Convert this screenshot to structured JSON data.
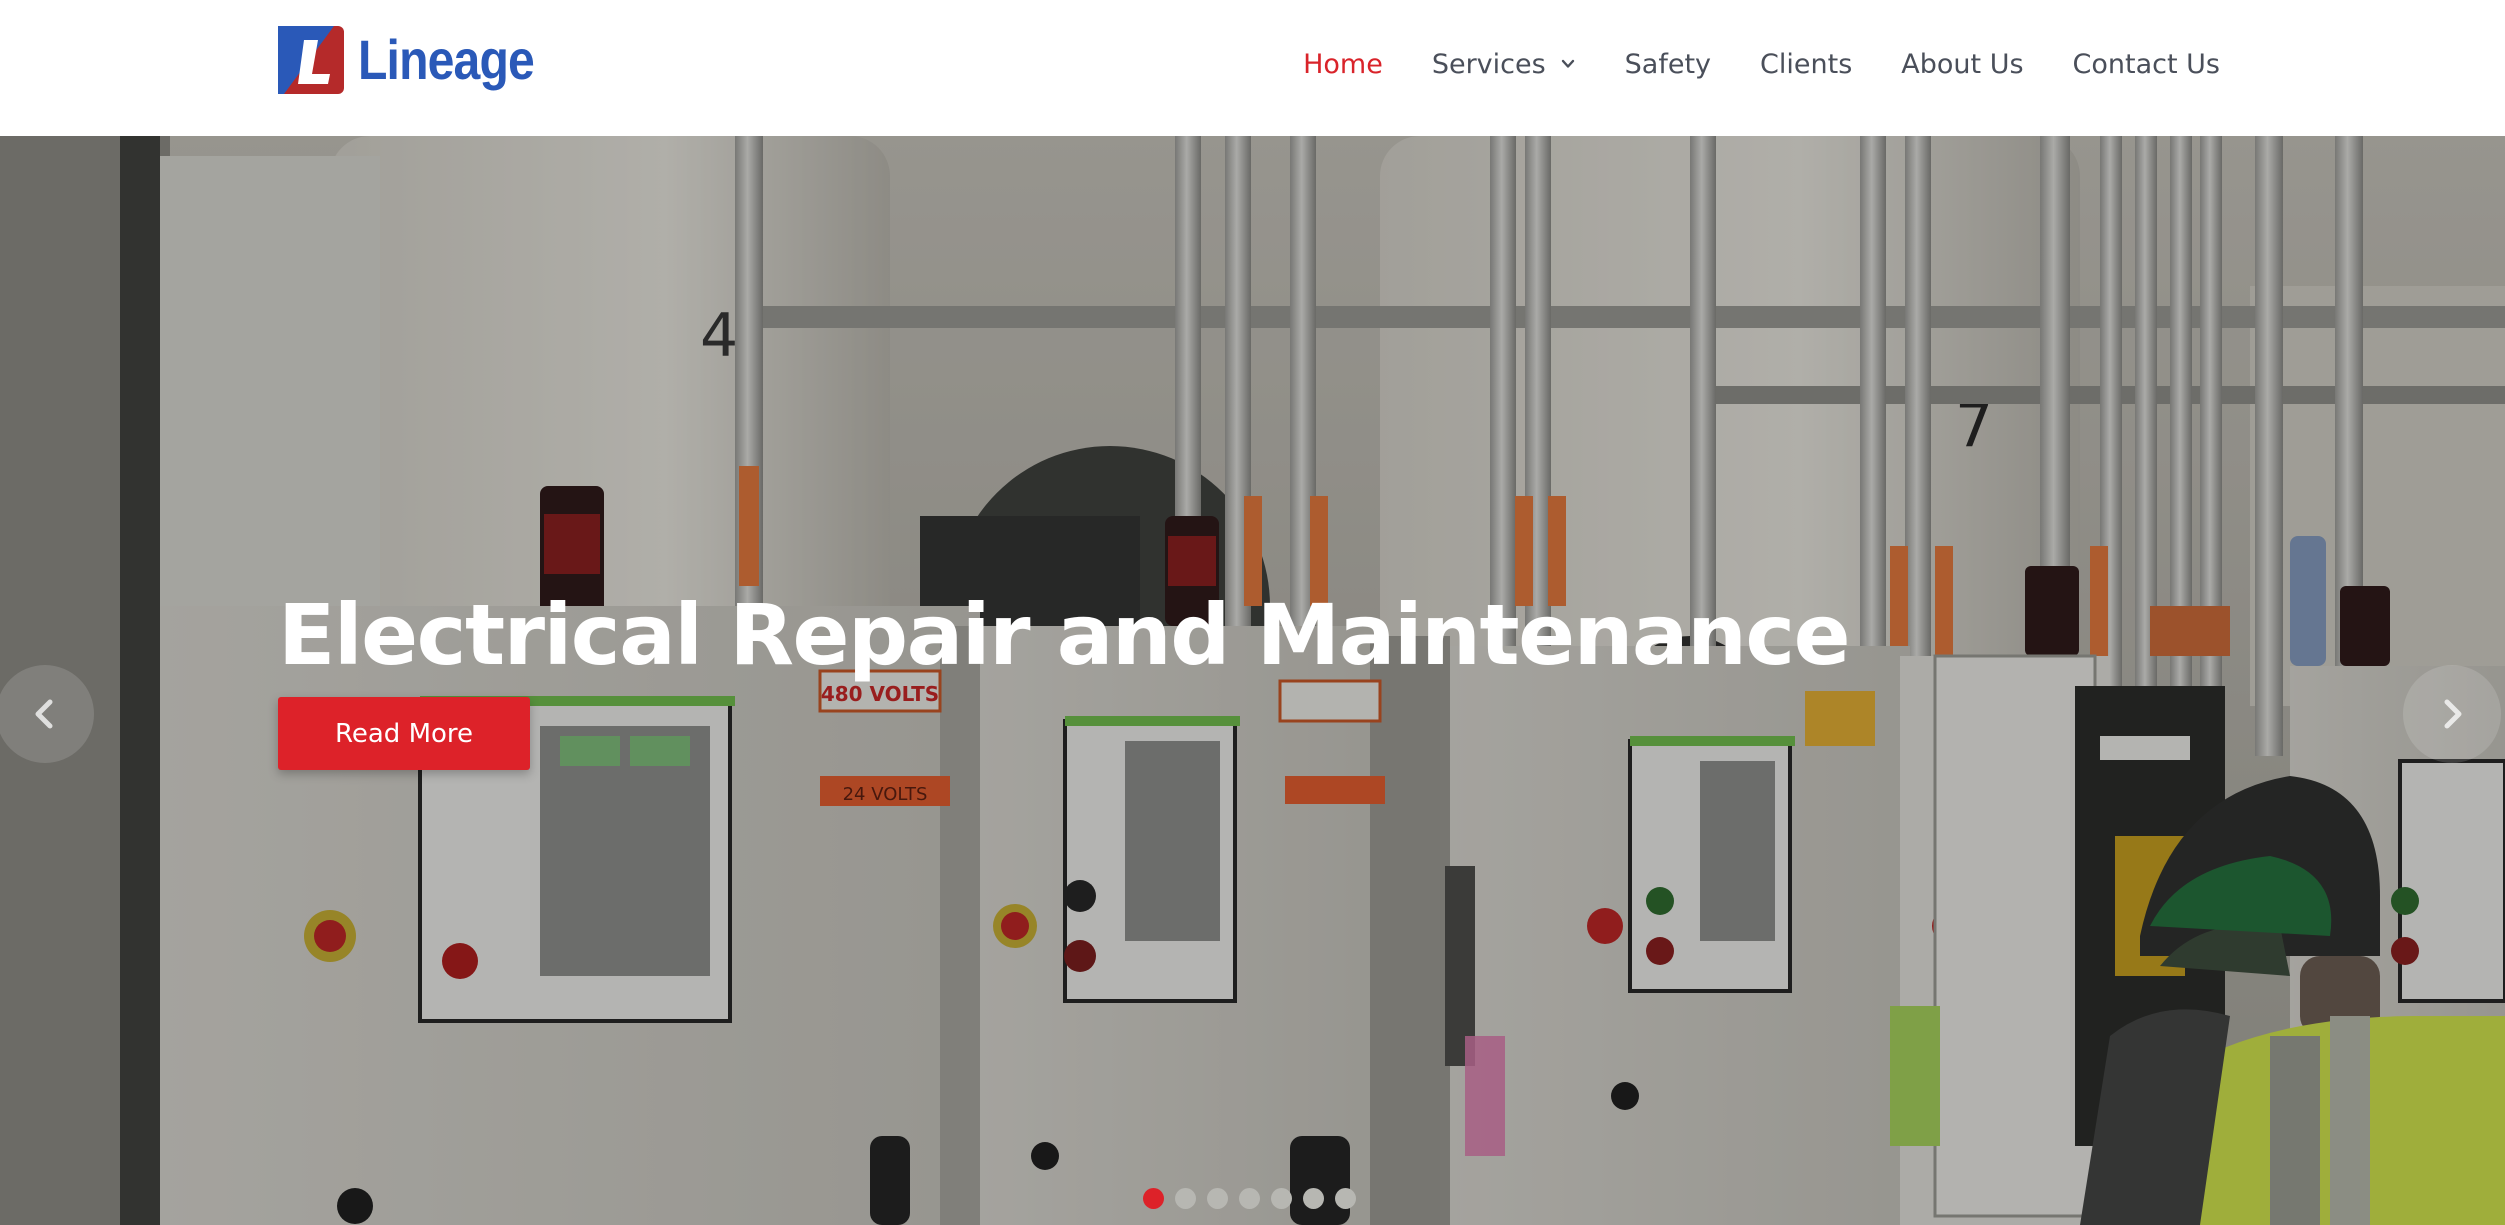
{
  "brand": {
    "name": "Lineage",
    "logo_icon": "lineage-logo-icon",
    "brand_blue": "#2a59b8",
    "brand_red": "#b52a2a"
  },
  "nav": {
    "items": [
      {
        "label": "Home",
        "active": true
      },
      {
        "label": "Services",
        "has_dropdown": true,
        "icon": "chevron-down-icon"
      },
      {
        "label": "Safety"
      },
      {
        "label": "Clients"
      },
      {
        "label": "About Us"
      },
      {
        "label": "Contact Us"
      }
    ],
    "active_color": "#d9232a",
    "text_color": "#4a4f5a"
  },
  "hero": {
    "title": "Electrical Repair and Maintenance",
    "cta_label": "Read More",
    "cta_color": "#dd2229",
    "prev_icon": "chevron-left-icon",
    "next_icon": "chevron-right-icon",
    "slides_count": 7,
    "active_slide": 1,
    "scene_labels": {
      "panel_voltage": "480 VOLTS",
      "control_voltage": "24 VOLTS",
      "number_4": "4",
      "number_7": "7"
    }
  }
}
